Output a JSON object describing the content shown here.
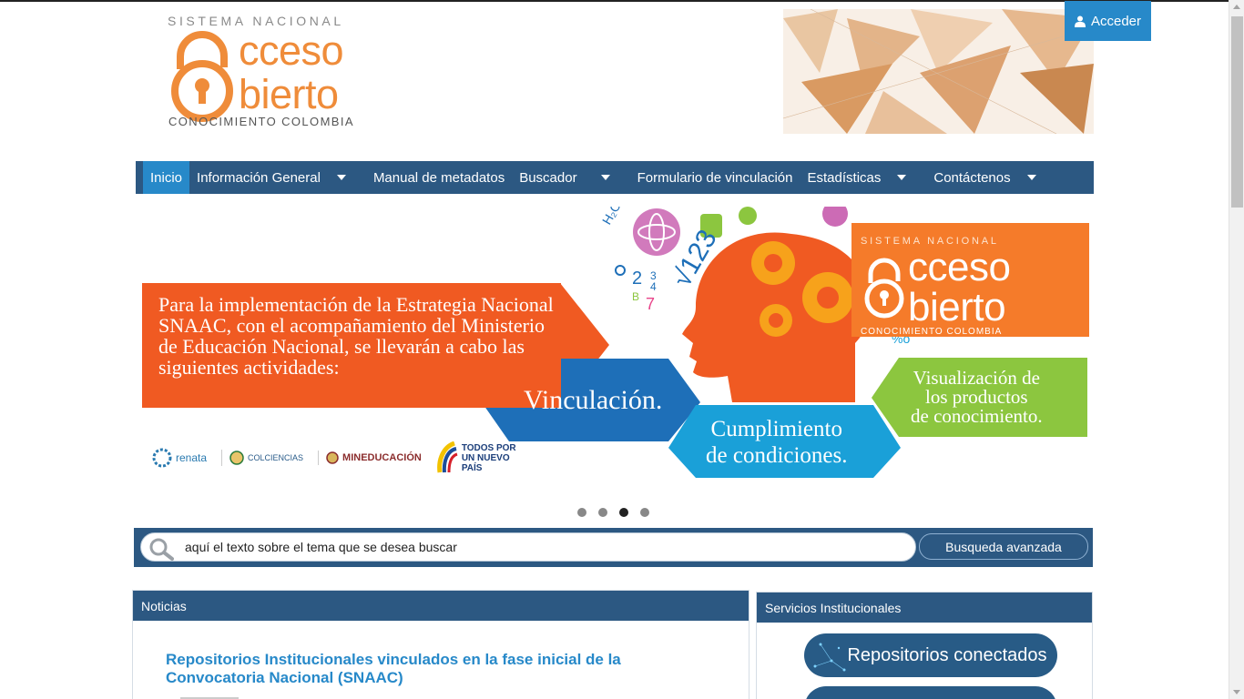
{
  "header": {
    "logo": {
      "top": "SISTEMA NACIONAL",
      "line1": "cceso",
      "line2": "bierto",
      "bottom": "CONOCIMIENTO COLOMBIA"
    },
    "login_label": "Acceder"
  },
  "nav": {
    "items": [
      {
        "label": "Inicio",
        "active": true,
        "dropdown": false
      },
      {
        "label": "Información General",
        "dropdown": true
      },
      {
        "label": "Manual de metadatos",
        "dropdown": false
      },
      {
        "label": "Buscador",
        "dropdown": true
      },
      {
        "label": "Formulario de vinculación",
        "dropdown": false
      },
      {
        "label": "Estadísticas",
        "dropdown": true
      },
      {
        "label": "Contáctenos",
        "dropdown": true
      }
    ]
  },
  "banner": {
    "intro": "Para la implementación de la Estrategia Nacional SNAAC, con el acompañamiento del Ministerio de Educación Nacional, se llevarán a cabo las siguientes actividades:",
    "step1": "Vinculación.",
    "step2_line1": "Cumplimiento",
    "step2_line2": "de condiciones.",
    "step3_line1": "Visualización de",
    "step3_line2": "los productos",
    "step3_line3": "de conocimiento.",
    "logo_top": "SISTEMA NACIONAL",
    "logo_line1": "cceso",
    "logo_line2": "bierto",
    "logo_bottom": "CONOCIMIENTO COLOMBIA",
    "partners": [
      "renata",
      "COLCIENCIAS",
      "MINEDUCACIÓN",
      "TODOS POR UN NUEVO PAÍS"
    ],
    "slide_count": 4,
    "active_slide": 3
  },
  "search": {
    "placeholder": "aquí el texto sobre el tema que se desea buscar",
    "advanced_label": "Busqueda avanzada"
  },
  "news": {
    "heading": "Noticias",
    "title": "Repositorios Institucionales vinculados en la fase inicial de la Convocatoria Nacional (SNAAC)"
  },
  "services": {
    "heading": "Servicios Institucionales",
    "button1": "Repositorios conectados"
  },
  "colors": {
    "nav_bg": "#2c5882",
    "accent_blue": "#2789c9",
    "brand_orange": "#ef8c3a"
  }
}
